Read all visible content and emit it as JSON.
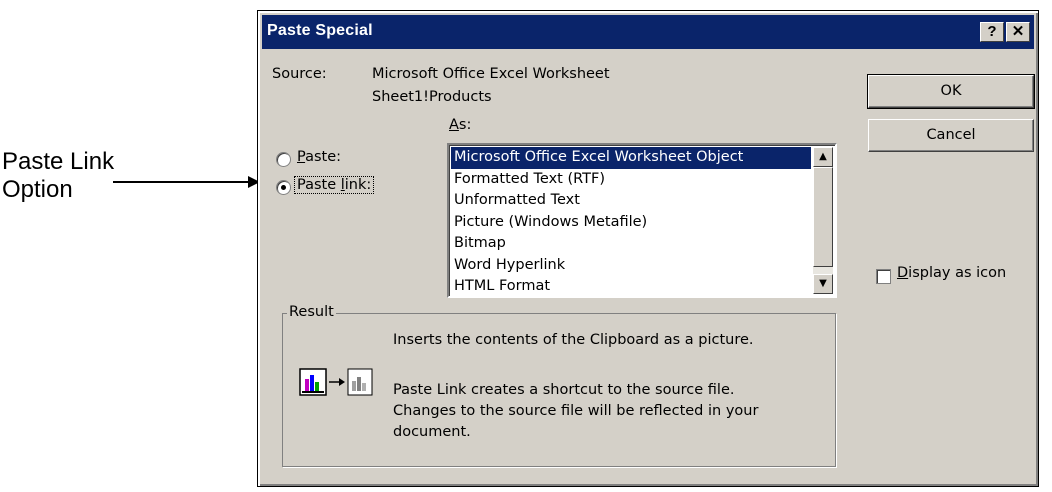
{
  "annotation": {
    "label": "Paste Link Option"
  },
  "dialog": {
    "title": "Paste Special",
    "help_button": "?",
    "close_button": "✕",
    "source_label": "Source:",
    "source_line1": "Microsoft Office Excel Worksheet",
    "source_line2": "Sheet1!Products",
    "as_label_accel": "A",
    "as_label_rest": "s:",
    "paste_radio": {
      "accel": "P",
      "rest": "aste:",
      "selected": false
    },
    "paste_link_radio": {
      "pre": "Paste ",
      "accel": "l",
      "rest": "ink:",
      "selected": true
    },
    "as_list": {
      "items": [
        "Microsoft Office Excel Worksheet Object",
        "Formatted Text (RTF)",
        "Unformatted Text",
        "Picture (Windows Metafile)",
        "Bitmap",
        "Word Hyperlink",
        "HTML Format"
      ],
      "selected_index": 0
    },
    "ok_button": "OK",
    "cancel_button": "Cancel",
    "display_as_icon": {
      "accel": "D",
      "rest": "isplay as icon",
      "checked": false
    },
    "result": {
      "legend": "Result",
      "line1": "Inserts the contents of the Clipboard as a picture.",
      "line2": "Paste Link creates a shortcut to the source file.",
      "line3": "Changes to the source file will be reflected in your",
      "line4": "document."
    }
  },
  "colors": {
    "titlebar": "#0a246a",
    "dialog_face": "#d4d0c8",
    "selection": "#0a246a"
  },
  "icons": [
    "help-icon",
    "close-icon",
    "scroll-up-icon",
    "scroll-down-icon",
    "paste-result-icon"
  ]
}
